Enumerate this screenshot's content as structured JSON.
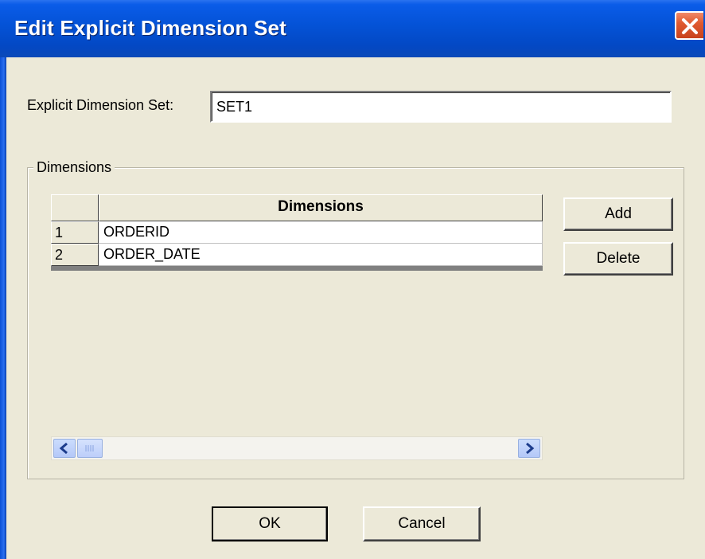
{
  "window": {
    "title": "Edit Explicit Dimension Set"
  },
  "set": {
    "label": "Explicit Dimension Set:",
    "value": "SET1"
  },
  "group": {
    "legend": "Dimensions"
  },
  "grid": {
    "column_header": "Dimensions",
    "rows": [
      {
        "num": "1",
        "value": "ORDERID"
      },
      {
        "num": "2",
        "value": "ORDER_DATE"
      }
    ]
  },
  "buttons": {
    "add": "Add",
    "delete": "Delete",
    "ok": "OK",
    "cancel": "Cancel"
  },
  "icons": {
    "close": "close-icon",
    "scroll_left": "chevron-left-icon",
    "scroll_right": "chevron-right-icon",
    "scroll_grip": "grip-icon"
  },
  "colors": {
    "titlebar": "#0452d6",
    "close": "#e05a30",
    "dialog_bg": "#ece9d8"
  }
}
